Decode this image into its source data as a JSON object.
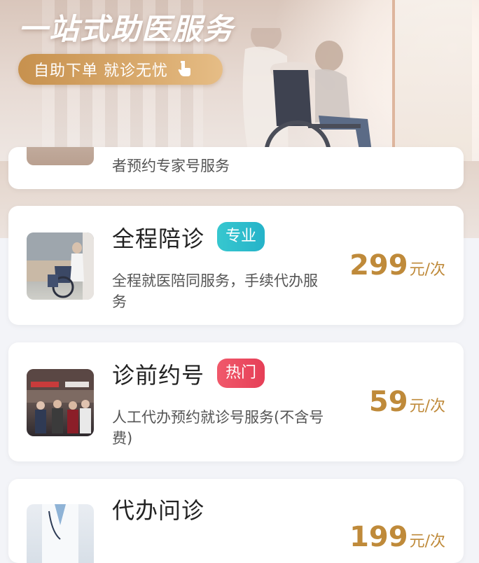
{
  "hero": {
    "title": "一站式助医服务",
    "cta_label": "自助下单 就诊无忧"
  },
  "partial_card": {
    "desc": "者预约专家号服务"
  },
  "services": [
    {
      "name": "全程陪诊",
      "badge": "专业",
      "badge_color": "#29b9cb",
      "desc": "全程就医陪同服务，手续代办服务",
      "price": "299",
      "unit": "元/次",
      "thumb_icon": "wheelchair-photo"
    },
    {
      "name": "诊前约号",
      "badge": "热门",
      "badge_color": "#e94a5f",
      "desc": "人工代办预约就诊号服务(不含号费)",
      "price": "59",
      "unit": "元/次",
      "thumb_icon": "hospital-hall-photo"
    },
    {
      "name": "代办问诊",
      "badge": "",
      "desc": "",
      "price": "199",
      "unit": "元/次",
      "thumb_icon": "doctor-photo"
    }
  ],
  "colors": {
    "accent_gold": "#bf8a3a",
    "page_bg": "#f3f4f8"
  }
}
